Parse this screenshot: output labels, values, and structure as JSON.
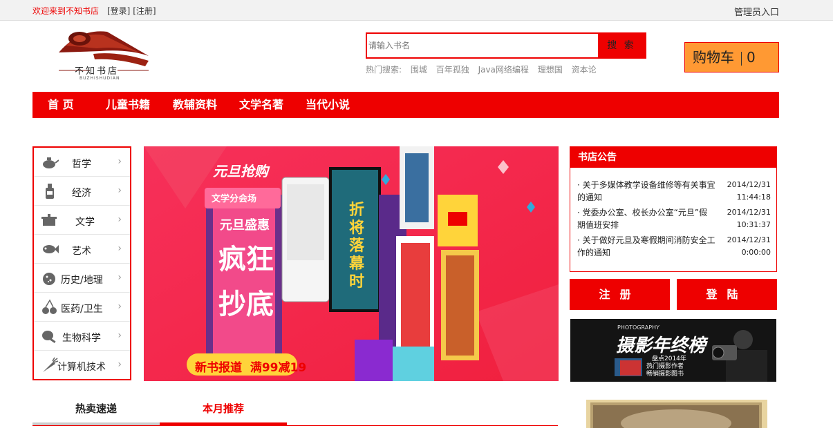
{
  "topbar": {
    "welcome": "欢迎来到不知书店",
    "login": "[登录]",
    "register": "[注册]",
    "admin": "管理员入口"
  },
  "logo": {
    "text": "不知书店",
    "sub": "BUZHISHUDIAN"
  },
  "search": {
    "placeholder": "请输入书名",
    "button": "搜 索",
    "hot_label": "热门搜索:",
    "hot_keywords": [
      "围城",
      "百年孤独",
      "Java网络编程",
      "理想国",
      "资本论"
    ]
  },
  "cart": {
    "label": "购物车",
    "count": "0"
  },
  "nav": {
    "items": [
      "首 页",
      "儿童书籍",
      "教辅资料",
      "文学名著",
      "当代小说"
    ]
  },
  "categories": [
    {
      "label": "哲学",
      "icon": "teapot-icon"
    },
    {
      "label": "经济",
      "icon": "bottle-icon"
    },
    {
      "label": "文学",
      "icon": "pot-icon"
    },
    {
      "label": "艺术",
      "icon": "fish-icon"
    },
    {
      "label": "历史/地理",
      "icon": "cookie-icon"
    },
    {
      "label": "医药/卫生",
      "icon": "cherry-icon"
    },
    {
      "label": "生物科学",
      "icon": "chicken-leg-icon"
    },
    {
      "label": "计算机技术",
      "icon": "carrot-icon"
    }
  ],
  "banner": {
    "brand": "元旦抢购",
    "tag": "文学分会场",
    "line1": "元旦盛惠",
    "line2": "疯狂",
    "line3": "抄底",
    "bottom": "新书报道  满99减19",
    "book1": "折将落幕时"
  },
  "notice": {
    "title": "书店公告",
    "items": [
      {
        "text": "· 关于多媒体教学设备维修等有关事宜的通知",
        "date": "2014/12/31",
        "time": "11:44:18"
      },
      {
        "text": "· 党委办公室、校长办公室“元旦”假期值班安排",
        "date": "2014/12/31",
        "time": "10:31:37"
      },
      {
        "text": "· 关于做好元旦及寒假期间消防安全工作的通知",
        "date": "2014/12/31",
        "time": "0:00:00"
      }
    ]
  },
  "buttons": {
    "register": "注册",
    "login": "登陆"
  },
  "ad": {
    "small": "PHOTOGRAPHY",
    "title": "摄影年终榜",
    "sub1": "盘点2014年",
    "sub2": "热门摄影作者",
    "sub3": "畅销摄影图书"
  },
  "tabs": {
    "hot": "热卖速递",
    "monthly": "本月推荐"
  },
  "colors": {
    "accent": "#ee0000",
    "cart": "#ff9933"
  }
}
